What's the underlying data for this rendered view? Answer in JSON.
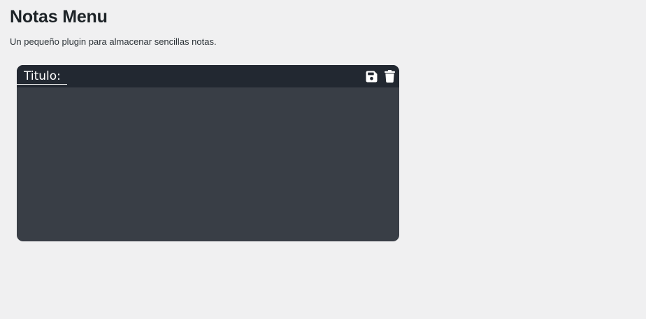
{
  "page": {
    "title": "Notas Menu",
    "description": "Un pequeño plugin para almacenar sencillas notas."
  },
  "note": {
    "title_placeholder": "Titulo:",
    "title_value": "",
    "body_value": "",
    "actions": {
      "save_icon": "floppy-disk-icon",
      "delete_icon": "trash-icon"
    }
  },
  "colors": {
    "page_background": "#f0f0f1",
    "header_background": "#222831",
    "body_background": "#393e46",
    "icon_color": "#ffffff"
  }
}
